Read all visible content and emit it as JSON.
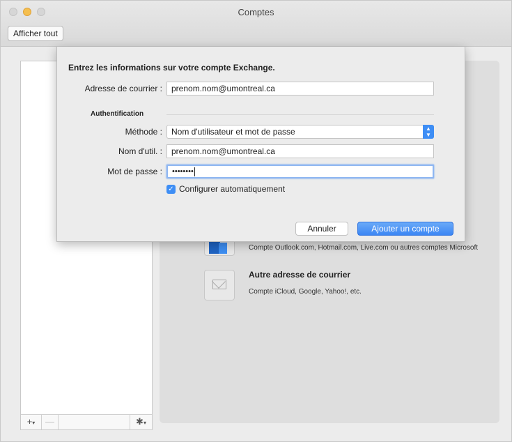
{
  "window": {
    "title": "Comptes",
    "show_all_label": "Afficher tout"
  },
  "account_list": {
    "add_symbol": "+",
    "remove_symbol": "—",
    "gear_symbol": "✱"
  },
  "account_options": {
    "outlook": {
      "description": "Compte Outlook.com, Hotmail.com, Live.com ou autres comptes Microsoft"
    },
    "other_mail": {
      "title": "Autre adresse de courrier",
      "description": "Compte iCloud, Google, Yahoo!, etc."
    }
  },
  "sheet": {
    "title": "Entrez les informations sur votre compte Exchange.",
    "email_label": "Adresse de courrier :",
    "email_value": "prenom.nom@umontreal.ca",
    "auth_section": "Authentification",
    "method_label": "Méthode :",
    "method_value": "Nom d'utilisateur et mot de passe",
    "username_label": "Nom d'util. :",
    "username_value": "prenom.nom@umontreal.ca",
    "password_label": "Mot de passe :",
    "password_value": "••••••••",
    "auto_config_label": "Configurer automatiquement",
    "auto_config_checked": true,
    "cancel_label": "Annuler",
    "add_account_label": "Ajouter un compte"
  },
  "colors": {
    "accent": "#3e8ef5",
    "traffic_minimize": "#f5bf4f"
  }
}
